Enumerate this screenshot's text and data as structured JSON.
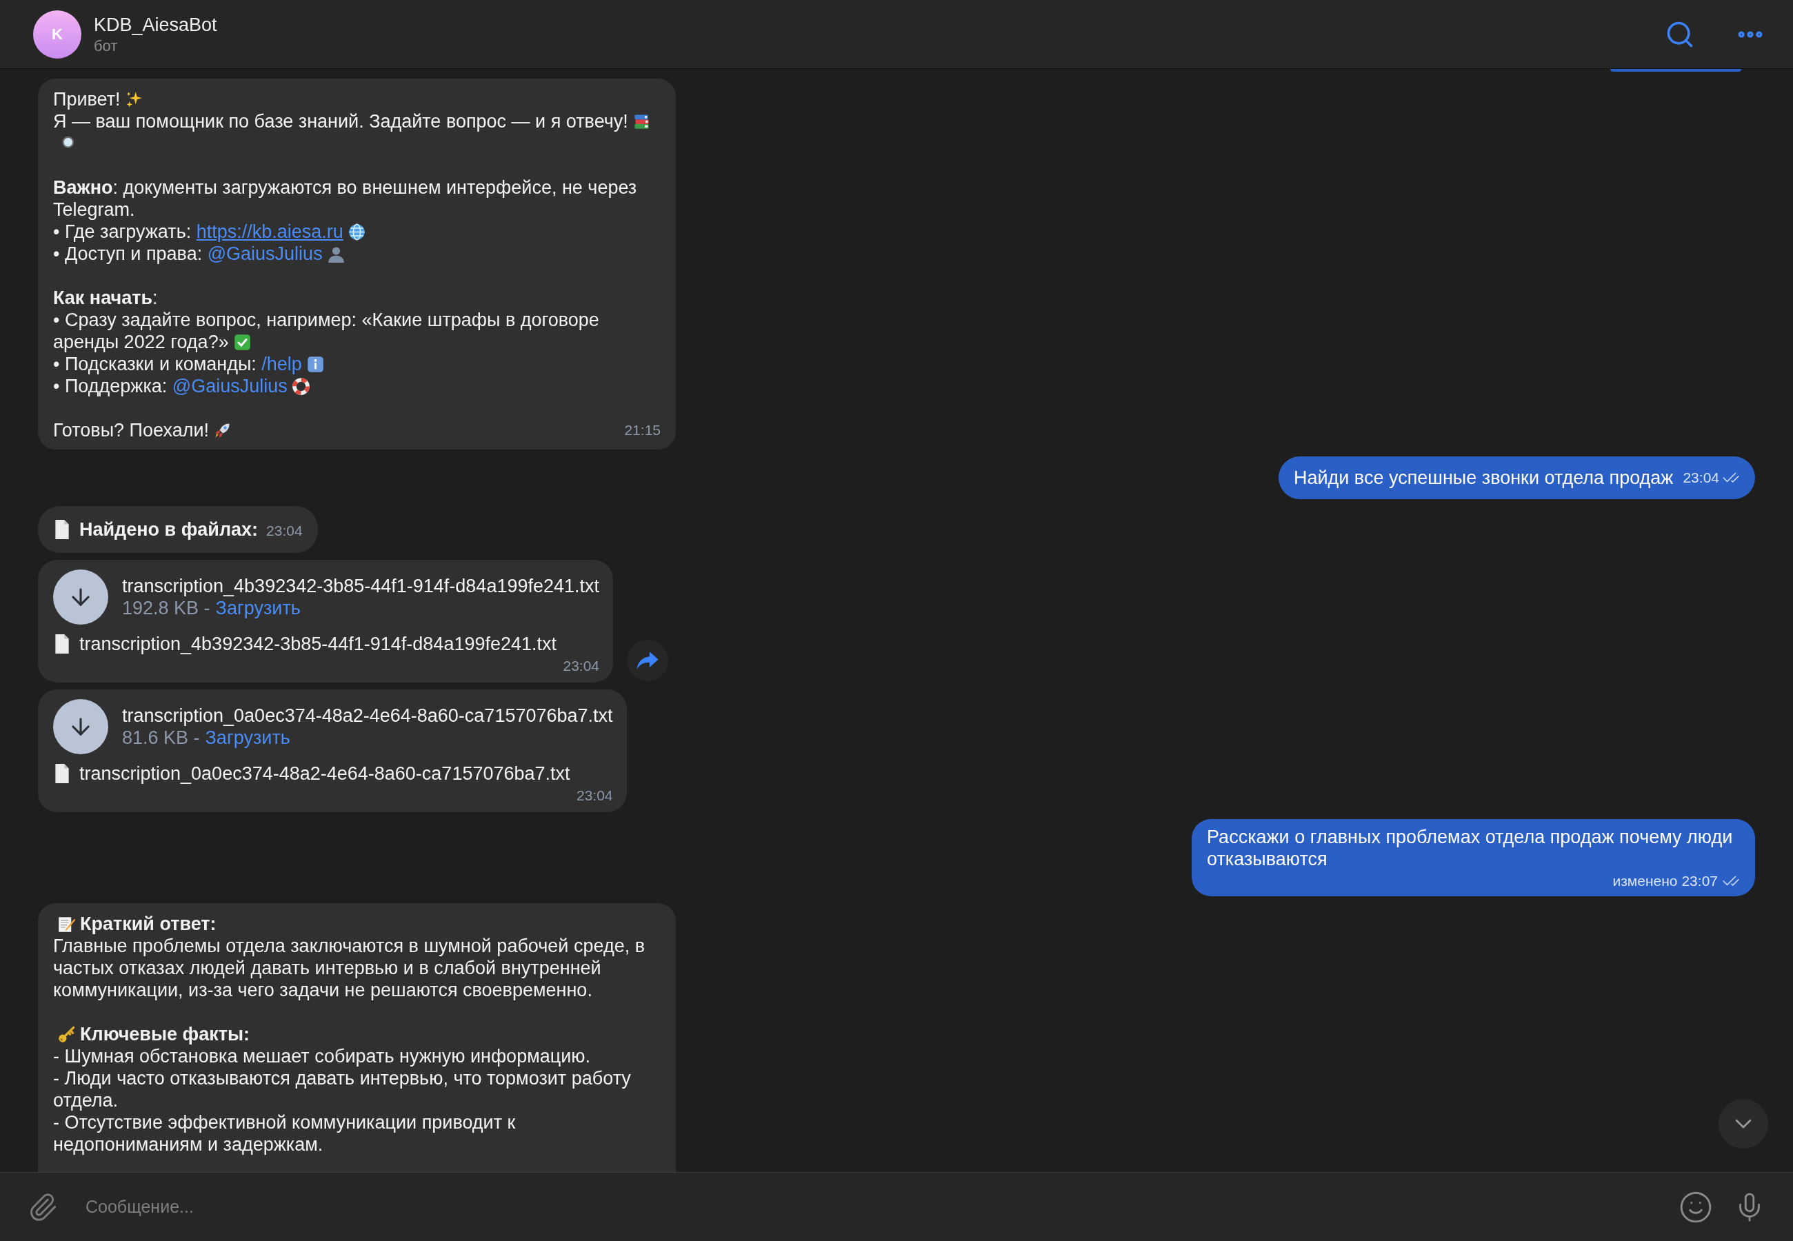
{
  "header": {
    "avatar_letter": "K",
    "title": "KDB_AiesaBot",
    "subtitle": "бот"
  },
  "messages": [
    {
      "kind": "rich",
      "time": "21:15",
      "paragraphs": [
        {
          "lines": [
            [
              {
                "kind": "text",
                "text": "Привет!"
              },
              {
                "kind": "sparkles"
              }
            ],
            [
              {
                "kind": "text",
                "text": "Я — ваш помощник по базе знаний. Задайте вопрос — и я отвечу!"
              },
              {
                "kind": "books"
              },
              {
                "kind": "magnifier"
              }
            ]
          ]
        },
        {
          "lines": [
            [
              {
                "kind": "text",
                "text": "**Важно**: документы загружаются во внешнем интерфейсе, не через Telegram."
              }
            ],
            [
              {
                "kind": "text",
                "text": "• Где загружать: "
              },
              {
                "kind": "url",
                "text": "https://kb.aiesa.ru"
              },
              {
                "kind": "globe"
              }
            ],
            [
              {
                "kind": "text",
                "text": "• Доступ и права: "
              },
              {
                "kind": "mention",
                "text": "@GaiusJulius"
              },
              {
                "kind": "person"
              }
            ]
          ]
        },
        {
          "lines": [
            [
              {
                "kind": "text",
                "text": "**Как начать**:"
              }
            ],
            [
              {
                "kind": "text",
                "text": "• Сразу задайте вопрос, например: «Какие штрафы в договоре аренды 2022 года?»"
              },
              {
                "kind": "check"
              }
            ],
            [
              {
                "kind": "text",
                "text": "• Подсказки и команды: "
              },
              {
                "kind": "command",
                "text": "/help"
              },
              {
                "kind": "info"
              }
            ],
            [
              {
                "kind": "text",
                "text": "• Поддержка: "
              },
              {
                "kind": "mention",
                "text": "@GaiusJulius"
              },
              {
                "kind": "lifebuoy"
              }
            ]
          ]
        },
        {
          "lines": [
            [
              {
                "kind": "text",
                "text": "Готовы? Поехали!"
              },
              {
                "kind": "rocket"
              }
            ]
          ]
        }
      ]
    },
    {
      "kind": "outgoing",
      "text": "Найди все успешные звонки отдела продаж",
      "time": "23:04",
      "read": true
    },
    {
      "kind": "files_header",
      "title": "Найдено в файлах:",
      "time": "23:04"
    },
    {
      "kind": "file",
      "name": "transcription_4b392342-3b85-44f1-914f-d84a199fe241.txt",
      "size": "192.8 KB -",
      "action": "Загрузить",
      "caption": "transcription_4b392342-3b85-44f1-914f-d84a199fe241.txt",
      "time": "23:04",
      "forward": true
    },
    {
      "kind": "file",
      "name": "transcription_0a0ec374-48a2-4e64-8a60-ca7157076ba7.txt",
      "size": "81.6 KB -",
      "action": "Загрузить",
      "caption": "transcription_0a0ec374-48a2-4e64-8a60-ca7157076ba7.txt",
      "time": "23:04",
      "forward": false
    },
    {
      "kind": "outgoing",
      "text": "Расскажи о главных проблемах отдела продаж почему люди отказываются",
      "edited": "изменено",
      "time": "23:07",
      "read": true
    },
    {
      "kind": "rich",
      "paragraphs": [
        {
          "lines": [
            [
              {
                "kind": "memo"
              },
              {
                "kind": "bold",
                "text": "Краткий ответ:"
              }
            ],
            [
              {
                "kind": "text",
                "text": "Главные проблемы отдела заключаются в шумной рабочей среде, в частых отказах людей давать интервью и в слабой внутренней коммуникации, из-за чего задачи не решаются своевременно."
              }
            ]
          ]
        },
        {
          "lines": [
            [
              {
                "kind": "key"
              },
              {
                "kind": "bold",
                "text": "Ключевые факты:"
              }
            ],
            [
              {
                "kind": "text",
                "text": "- Шумная обстановка мешает собирать нужную информацию."
              }
            ],
            [
              {
                "kind": "text",
                "text": "- Люди часто отказываются давать интервью, что тормозит работу отдела."
              }
            ],
            [
              {
                "kind": "text",
                "text": "- Отсутствие эффективной коммуникации приводит к недопониманиям и задержкам."
              }
            ]
          ]
        }
      ]
    }
  ],
  "composer": {
    "placeholder": "Сообщение..."
  }
}
